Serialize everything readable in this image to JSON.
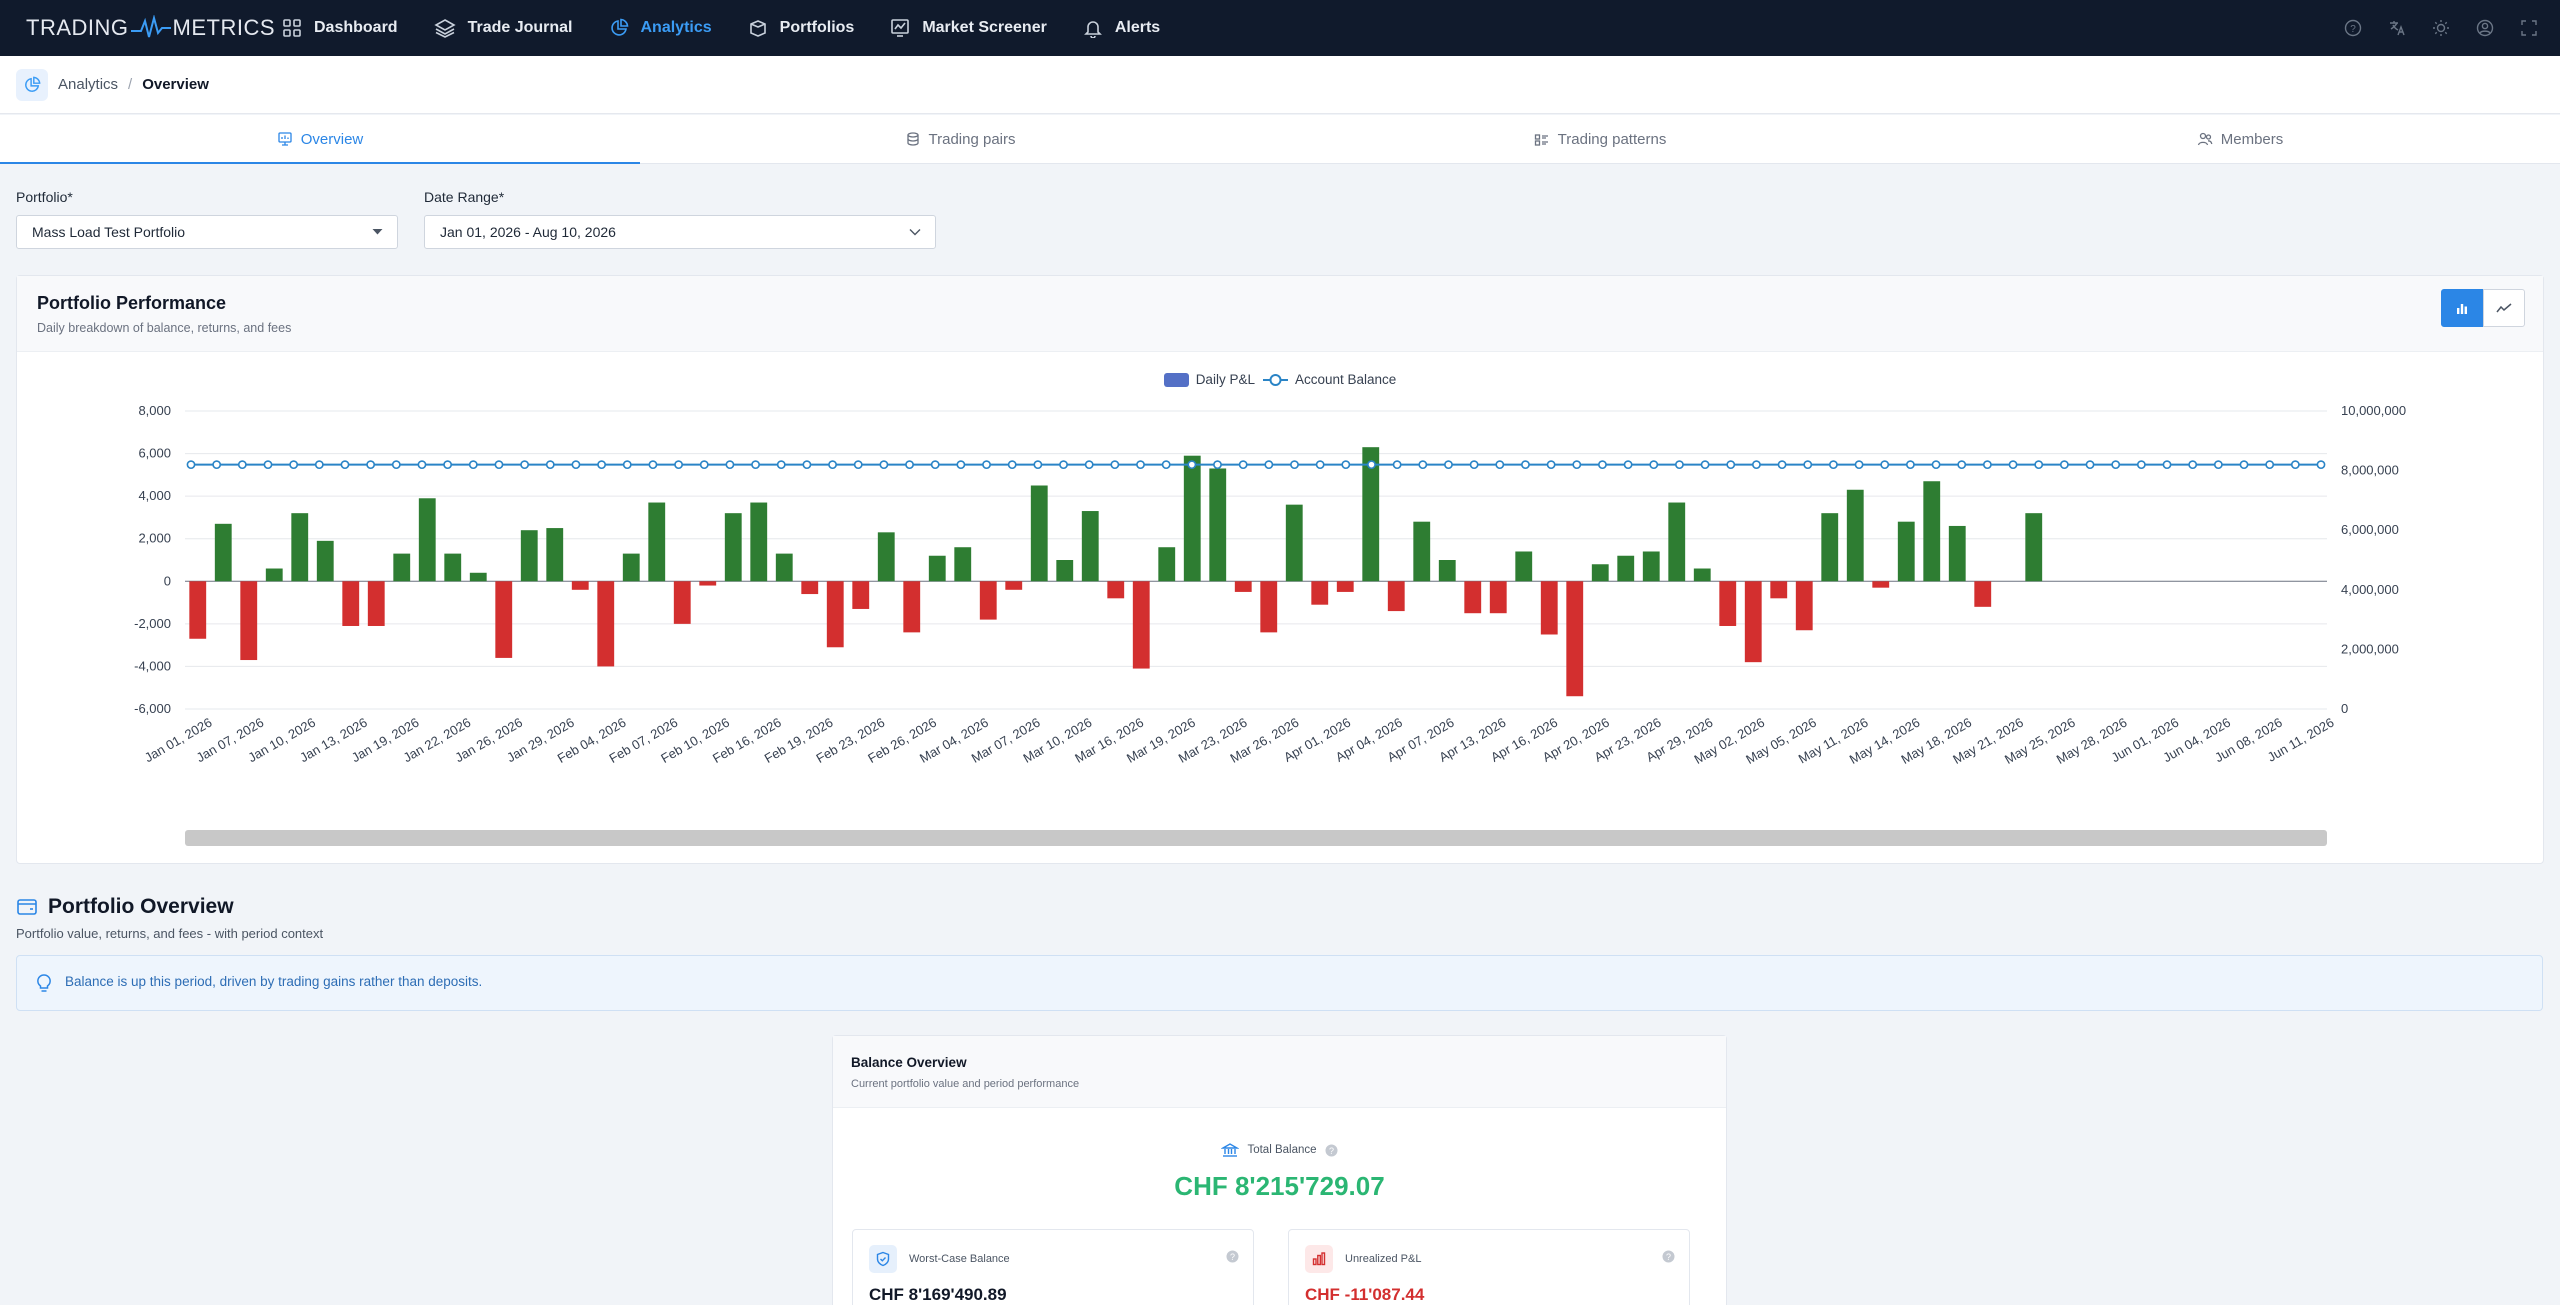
{
  "nav": {
    "logo_left": "TRADING",
    "logo_right": "METRICS",
    "items": [
      {
        "label": "Dashboard",
        "icon": "grid-icon"
      },
      {
        "label": "Trade Journal",
        "icon": "layers-icon"
      },
      {
        "label": "Analytics",
        "icon": "pie-icon"
      },
      {
        "label": "Portfolios",
        "icon": "box-icon"
      },
      {
        "label": "Market Screener",
        "icon": "screener-icon"
      },
      {
        "label": "Alerts",
        "icon": "bell-icon"
      }
    ],
    "active": "Analytics",
    "right_icons": [
      "help-icon",
      "translate-icon",
      "sun-icon",
      "user-icon",
      "fullscreen-icon"
    ]
  },
  "breadcrumb": {
    "parent": "Analytics",
    "separator": "/",
    "current": "Overview"
  },
  "tabs": [
    {
      "label": "Overview",
      "icon": "overview-icon",
      "active": true
    },
    {
      "label": "Trading pairs",
      "icon": "coins-icon",
      "active": false
    },
    {
      "label": "Trading patterns",
      "icon": "patterns-icon",
      "active": false
    },
    {
      "label": "Members",
      "icon": "members-icon",
      "active": false
    }
  ],
  "filters": {
    "portfolio_label": "Portfolio*",
    "portfolio_value": "Mass Load Test Portfolio",
    "date_label": "Date Range*",
    "date_value": "Jan 01, 2026 - Aug 10, 2026"
  },
  "performance": {
    "title": "Portfolio Performance",
    "subtitle": "Daily breakdown of balance, returns, and fees",
    "view_toggle": [
      "bar-chart-icon",
      "line-chart-icon"
    ],
    "active_view": "bar"
  },
  "chart_data": {
    "type": "bar",
    "legend_position": "top-center",
    "grid": true,
    "series": [
      {
        "name": "Daily P&L",
        "type": "bar",
        "axis": "left",
        "color": "#5470c6"
      },
      {
        "name": "Account Balance",
        "type": "line",
        "axis": "right",
        "color": "#2a84c6"
      }
    ],
    "positive_color": "#2e7d32",
    "negative_color": "#d32f2f",
    "y_left": {
      "ylim": [
        -6000,
        8000
      ],
      "ticks": [
        "8,000",
        "6,000",
        "4,000",
        "2,000",
        "0",
        "-2,000",
        "-4,000",
        "-6,000"
      ]
    },
    "y_right": {
      "ylim": [
        0,
        10000000
      ],
      "ticks": [
        "10,000,000",
        "8,000,000",
        "6,000,000",
        "4,000,000",
        "2,000,000",
        "0"
      ]
    },
    "x_tick_labels": [
      "Jan 01, 2026",
      "Jan 07, 2026",
      "Jan 10, 2026",
      "Jan 13, 2026",
      "Jan 19, 2026",
      "Jan 22, 2026",
      "Jan 26, 2026",
      "Jan 29, 2026",
      "Feb 04, 2026",
      "Feb 07, 2026",
      "Feb 10, 2026",
      "Feb 16, 2026",
      "Feb 19, 2026",
      "Feb 23, 2026",
      "Feb 26, 2026",
      "Mar 04, 2026",
      "Mar 07, 2026",
      "Mar 10, 2026",
      "Mar 16, 2026",
      "Mar 19, 2026",
      "Mar 23, 2026",
      "Mar 26, 2026",
      "Apr 01, 2026",
      "Apr 04, 2026",
      "Apr 07, 2026",
      "Apr 13, 2026",
      "Apr 16, 2026",
      "Apr 20, 2026",
      "Apr 23, 2026",
      "Apr 29, 2026",
      "May 02, 2026",
      "May 05, 2026",
      "May 11, 2026",
      "May 14, 2026",
      "May 18, 2026",
      "May 21, 2026",
      "May 25, 2026",
      "May 28, 2026",
      "Jun 01, 2026",
      "Jun 04, 2026",
      "Jun 08, 2026",
      "Jun 11, 2026"
    ],
    "daily_pnl": [
      -2700,
      2700,
      -3700,
      600,
      3200,
      1900,
      -2100,
      -2100,
      1300,
      3900,
      1300,
      400,
      -3600,
      2400,
      2500,
      -400,
      -4000,
      1300,
      3700,
      -2000,
      -200,
      3200,
      3700,
      1300,
      -600,
      -3100,
      -1300,
      2300,
      -2400,
      1200,
      1600,
      -1800,
      -400,
      4500,
      1000,
      3300,
      -800,
      -4100,
      1600,
      5900,
      5300,
      -500,
      -2400,
      3600,
      -1100,
      -500,
      6300,
      -1400,
      2800,
      1000,
      -1500,
      -1500,
      1400,
      -2500,
      -5400,
      800,
      1200,
      1400,
      3700,
      600,
      -2100,
      -3800,
      -800,
      -2300,
      3200,
      4300,
      -300,
      2800,
      4700,
      2600,
      -1200,
      0,
      3200,
      0,
      0,
      0,
      0,
      0,
      0,
      0,
      0,
      0,
      0,
      0
    ],
    "account_balance": 8200000,
    "balance_points": 84
  },
  "overview": {
    "title": "Portfolio Overview",
    "subtitle": "Portfolio value, returns, and fees - with period context",
    "insight": "Balance is up this period, driven by trading gains rather than deposits.",
    "balance_card": {
      "title": "Balance Overview",
      "subtitle": "Current portfolio value and period performance",
      "total_label": "Total Balance",
      "total_value": "CHF 8'215'729.07",
      "worst_label": "Worst-Case Balance",
      "worst_value": "CHF 8'169'490.89",
      "unrealized_label": "Unrealized P&L",
      "unrealized_value": "CHF -11'087.44"
    }
  }
}
